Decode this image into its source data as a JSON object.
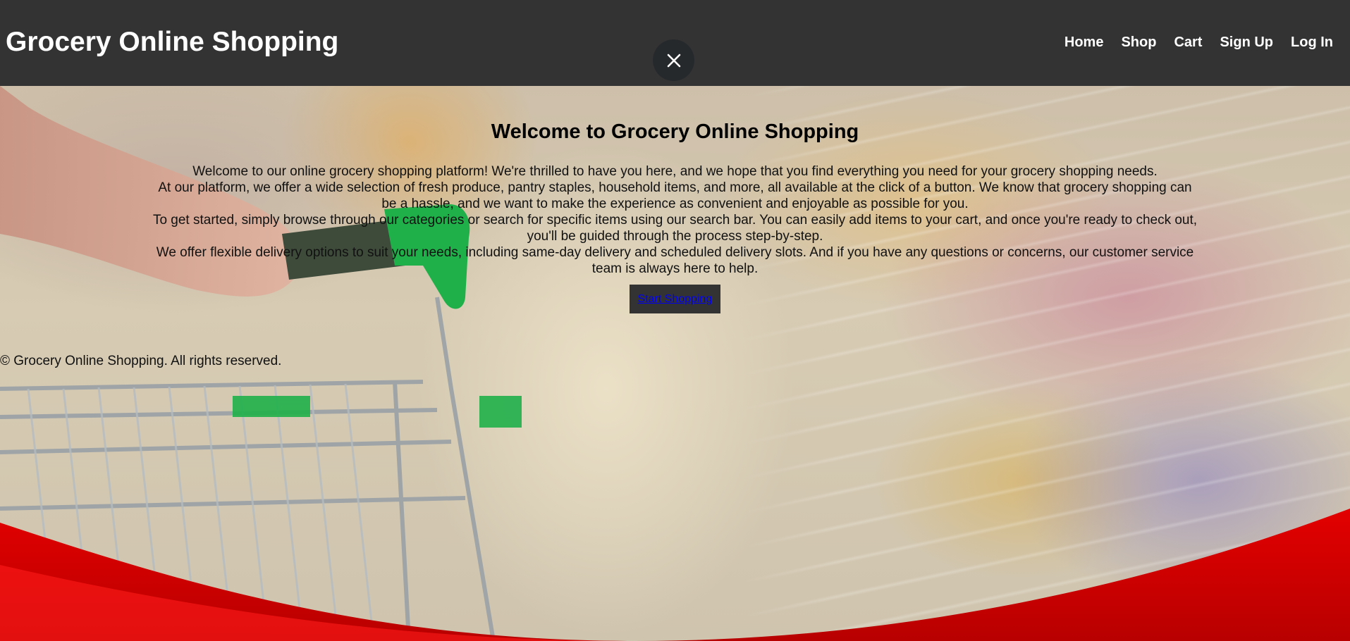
{
  "header": {
    "title": "Grocery Online Shopping",
    "nav": [
      "Home",
      "Shop",
      "Cart",
      "Sign Up",
      "Log In"
    ]
  },
  "close_icon": "close-icon",
  "main": {
    "heading": "Welcome to Grocery Online Shopping",
    "paragraphs": [
      "Welcome to our online grocery shopping platform! We're thrilled to have you here, and we hope that you find everything you need for your grocery shopping needs.",
      "At our platform, we offer a wide selection of fresh produce, pantry staples, household items, and more, all available at the click of a button. We know that grocery shopping can be a hassle, and we want to make the experience as convenient and enjoyable as possible for you.",
      "To get started, simply browse through our categories or search for specific items using our search bar. You can easily add items to your cart, and once you're ready to check out, you'll be guided through the process step-by-step.",
      "We offer flexible delivery options to suit your needs, including same-day delivery and scheduled delivery slots. And if you have any questions or concerns, our customer service team is always here to help."
    ],
    "cta_label": "Start Shopping"
  },
  "footer": {
    "text": "© Grocery Online Shopping. All rights reserved."
  },
  "colors": {
    "header_bg": "#333333",
    "accent_red": "#e00000",
    "cart_green": "#1fb04a",
    "link": "#0000ee"
  }
}
